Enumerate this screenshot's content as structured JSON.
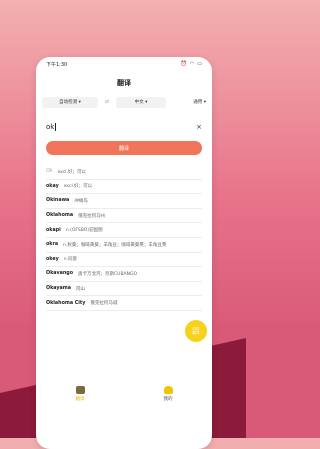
{
  "status": {
    "time": "下午1:30",
    "icons": [
      "alarm-icon",
      "wifi-icon",
      "battery-icon"
    ]
  },
  "header": {
    "title": "翻译"
  },
  "languages": {
    "source": "自动检测",
    "target": "中文",
    "general": "通用",
    "swap": "⇄"
  },
  "input": {
    "value": "ok",
    "clear": "×"
  },
  "translate_button": {
    "label": "翻译"
  },
  "suggestions": [
    {
      "word": "Ok",
      "meaning": "excl.好；可以",
      "light": true
    },
    {
      "word": "okay",
      "meaning": "excl.好；可以"
    },
    {
      "word": "Okinawa",
      "meaning": "冲绳岛"
    },
    {
      "word": "Oklahoma",
      "meaning": "俄克拉何马州"
    },
    {
      "word": "okapi",
      "meaning": "n.(OFSBO)迎国图"
    },
    {
      "word": "okra",
      "meaning": "n.秋葵；咖啡黄葵；羊角豆；咖啡黄葵荚；羊角豆荚"
    },
    {
      "word": "okey",
      "meaning": "n.同意"
    },
    {
      "word": "Okavango",
      "meaning": "奥卡万戈河；奈斯CUBANGO"
    },
    {
      "word": "Okayama",
      "meaning": "冈山"
    },
    {
      "word": "Oklahoma City",
      "meaning": "俄克拉何马城"
    }
  ],
  "float_button": {
    "line1": "内容",
    "line2": "翻译"
  },
  "tabs": [
    {
      "label": "翻译",
      "active": true
    },
    {
      "label": "我的",
      "active": false
    }
  ],
  "colors": {
    "accent": "#f0755a",
    "float": "#f7d21a",
    "tab_active": "#e8b400"
  }
}
